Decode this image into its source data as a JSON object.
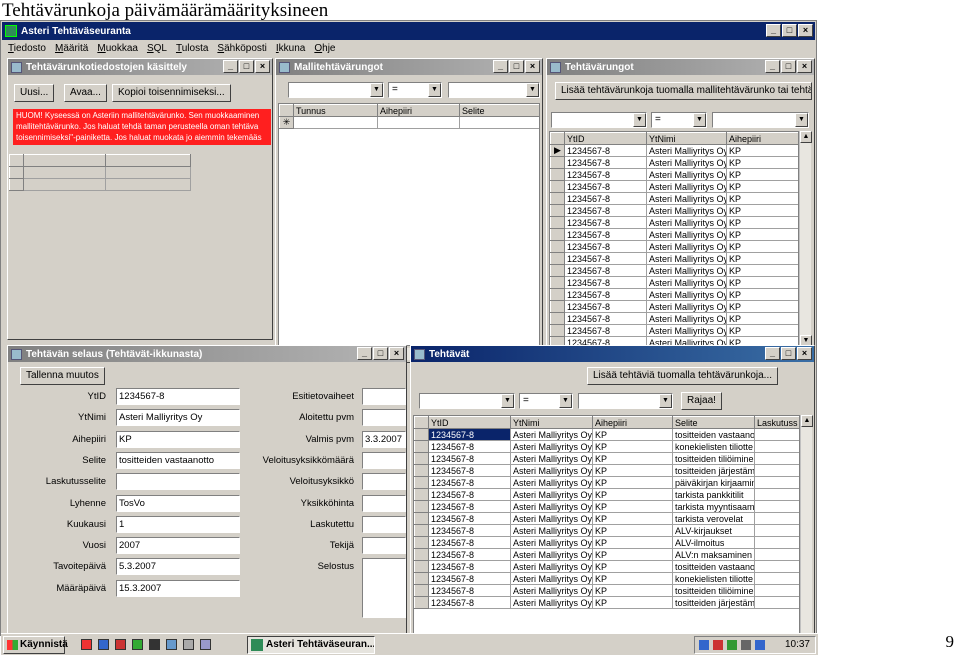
{
  "page": {
    "heading": "Tehtävärunkoja päivämäärämäärityksineen",
    "number": "9"
  },
  "app": {
    "title": "Asteri Tehtäväseuranta",
    "menu": [
      "Tiedosto",
      "Määritä",
      "Muokkaa",
      "SQL",
      "Tulosta",
      "Sähköposti",
      "Ikkuna",
      "Ohje"
    ]
  },
  "controls": {
    "minimize": "_",
    "maximize": "□",
    "close": "×",
    "dropdown_arrow": "▼",
    "scroll_up": "▲",
    "scroll_down": "▼",
    "scroll_left": "◄",
    "scroll_right": "►",
    "row_current": "▶",
    "row_new": "✳"
  },
  "win_runko": {
    "title": "Tehtävärunkotiedostojen käsittely",
    "btn_new": "Uusi...",
    "btn_open": "Avaa...",
    "btn_copy": "Kopioi toisennimiseksi...",
    "alert": "HUOM! Kyseessä on Asteriin mallitehtävärunko. Sen muokkaaminen mallitehtävärunko. Jos haluat tehdä taman perusteella oman tehtäva toisennimiseksi\"-painiketta. Jos haluat muokata jo aiemmin tekemääs"
  },
  "win_malli": {
    "title": "Mallitehtävärungot",
    "filter_op": "=",
    "columns": [
      "Tunnus",
      "Aihepiiri",
      "Selite"
    ]
  },
  "win_tehtavarungot": {
    "title": "Tehtävärungot",
    "btn_add": "Lisää tehtävärunkoja tuomalla mallitehtävärunko tai tehtävärunkot",
    "filter_op": "=",
    "columns": [
      "YtID",
      "YtNimi",
      "Aihepiiri"
    ],
    "rows": [
      [
        "1234567-8",
        "Asteri Malliyritys Oy",
        "KP"
      ],
      [
        "1234567-8",
        "Asteri Malliyritys Oy",
        "KP"
      ],
      [
        "1234567-8",
        "Asteri Malliyritys Oy",
        "KP"
      ],
      [
        "1234567-8",
        "Asteri Malliyritys Oy",
        "KP"
      ],
      [
        "1234567-8",
        "Asteri Malliyritys Oy",
        "KP"
      ],
      [
        "1234567-8",
        "Asteri Malliyritys Oy",
        "KP"
      ],
      [
        "1234567-8",
        "Asteri Malliyritys Oy",
        "KP"
      ],
      [
        "1234567-8",
        "Asteri Malliyritys Oy",
        "KP"
      ],
      [
        "1234567-8",
        "Asteri Malliyritys Oy",
        "KP"
      ],
      [
        "1234567-8",
        "Asteri Malliyritys Oy",
        "KP"
      ],
      [
        "1234567-8",
        "Asteri Malliyritys Oy",
        "KP"
      ],
      [
        "1234567-8",
        "Asteri Malliyritys Oy",
        "KP"
      ],
      [
        "1234567-8",
        "Asteri Malliyritys Oy",
        "KP"
      ],
      [
        "1234567-8",
        "Asteri Malliyritys Oy",
        "KP"
      ],
      [
        "1234567-8",
        "Asteri Malliyritys Oy",
        "KP"
      ],
      [
        "1234567-8",
        "Asteri Malliyritys Oy",
        "KP"
      ],
      [
        "1234567-8",
        "Asteri Malliyritys Oy",
        "KP"
      ]
    ]
  },
  "win_selaus": {
    "title": "Tehtävän selaus (Tehtävät-ikkunasta)",
    "btn_save": "Tallenna muutos",
    "left_fields": [
      {
        "label": "YtID",
        "value": "1234567-8"
      },
      {
        "label": "YtNimi",
        "value": "Asteri Malliyritys Oy"
      },
      {
        "label": "Aihepiiri",
        "value": "KP"
      },
      {
        "label": "Selite",
        "value": "tositteiden vastaanotto"
      },
      {
        "label": "Laskutusselite",
        "value": ""
      },
      {
        "label": "Lyhenne",
        "value": "TosVo"
      },
      {
        "label": "Kuukausi",
        "value": "1"
      },
      {
        "label": "Vuosi",
        "value": "2007"
      },
      {
        "label": "Tavoitepäivä",
        "value": "5.3.2007"
      },
      {
        "label": "Määräpäivä",
        "value": "15.3.2007"
      }
    ],
    "right_fields": [
      {
        "label": "Esitietovaiheet",
        "value": ""
      },
      {
        "label": "Aloitettu pvm",
        "value": ""
      },
      {
        "label": "Valmis pvm",
        "value": "3.3.2007"
      },
      {
        "label": "Veloitusyksikkömäärä",
        "value": ""
      },
      {
        "label": "Veloitusyksikkö",
        "value": ""
      },
      {
        "label": "Yksikköhinta",
        "value": ""
      },
      {
        "label": "Laskutettu",
        "value": ""
      },
      {
        "label": "Tekijä",
        "value": ""
      },
      {
        "label": "Selostus",
        "value": ""
      }
    ]
  },
  "win_tehtavat": {
    "title": "Tehtävät",
    "btn_add": "Lisää tehtäviä tuomalla tehtävärunkoja...",
    "filter_op": "=",
    "btn_filter": "Rajaa!",
    "columns": [
      "YtID",
      "YtNimi",
      "Aihepiiri",
      "Selite",
      "Laskutuss"
    ],
    "rows": [
      [
        "1234567-8",
        "Asteri Malliyritys Oy",
        "KP",
        "tositteiden vastaanot",
        ""
      ],
      [
        "1234567-8",
        "Asteri Malliyritys Oy",
        "KP",
        "konekielisten tiliotte",
        ""
      ],
      [
        "1234567-8",
        "Asteri Malliyritys Oy",
        "KP",
        "tositteiden tiliöimine",
        ""
      ],
      [
        "1234567-8",
        "Asteri Malliyritys Oy",
        "KP",
        "tositteiden järjestämir",
        ""
      ],
      [
        "1234567-8",
        "Asteri Malliyritys Oy",
        "KP",
        "päiväkirjan kirjaamine",
        ""
      ],
      [
        "1234567-8",
        "Asteri Malliyritys Oy",
        "KP",
        "tarkista pankkitilit",
        ""
      ],
      [
        "1234567-8",
        "Asteri Malliyritys Oy",
        "KP",
        "tarkista myyntisaamis",
        ""
      ],
      [
        "1234567-8",
        "Asteri Malliyritys Oy",
        "KP",
        "tarkista verovelat",
        ""
      ],
      [
        "1234567-8",
        "Asteri Malliyritys Oy",
        "KP",
        "ALV-kirjaukset",
        ""
      ],
      [
        "1234567-8",
        "Asteri Malliyritys Oy",
        "KP",
        "ALV-ilmoitus",
        ""
      ],
      [
        "1234567-8",
        "Asteri Malliyritys Oy",
        "KP",
        "ALV:n maksaminen",
        ""
      ],
      [
        "1234567-8",
        "Asteri Malliyritys Oy",
        "KP",
        "tositteiden vastaanot",
        ""
      ],
      [
        "1234567-8",
        "Asteri Malliyritys Oy",
        "KP",
        "konekielisten tiliotte",
        ""
      ],
      [
        "1234567-8",
        "Asteri Malliyritys Oy",
        "KP",
        "tositteiden tiliöimine",
        ""
      ],
      [
        "1234567-8",
        "Asteri Malliyritys Oy",
        "KP",
        "tositteiden järjestämir",
        ""
      ]
    ]
  },
  "taskbar": {
    "start": "Käynnistä",
    "task": "Asteri Tehtäväseuran...",
    "clock": "10:37"
  }
}
